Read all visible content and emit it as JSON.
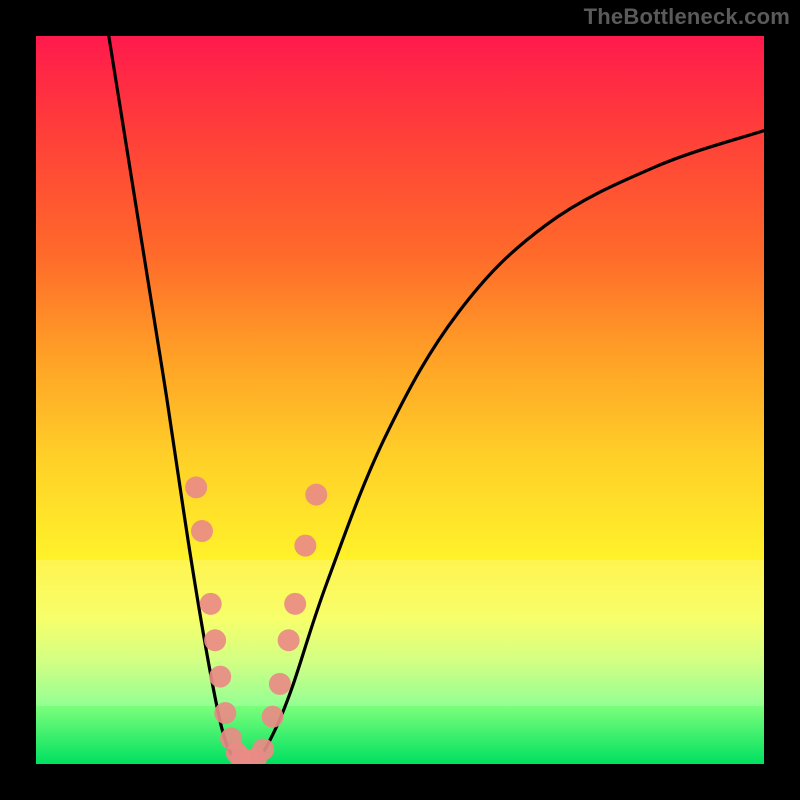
{
  "watermark": "TheBottleneck.com",
  "chart_data": {
    "type": "line",
    "title": "",
    "xlabel": "",
    "ylabel": "",
    "xlim": [
      0,
      100
    ],
    "ylim": [
      0,
      100
    ],
    "series": [
      {
        "name": "left-curve",
        "x": [
          10,
          14,
          18,
          21,
          23.5,
          25.5,
          27,
          28
        ],
        "y": [
          100,
          75,
          50,
          30,
          15,
          5,
          1,
          0
        ]
      },
      {
        "name": "right-curve",
        "x": [
          30,
          32,
          35,
          40,
          48,
          58,
          70,
          85,
          100
        ],
        "y": [
          0,
          3,
          10,
          25,
          45,
          62,
          74,
          82,
          87
        ]
      }
    ],
    "markers": [
      {
        "x": 22.0,
        "y": 38
      },
      {
        "x": 22.8,
        "y": 32
      },
      {
        "x": 24.0,
        "y": 22
      },
      {
        "x": 24.6,
        "y": 17
      },
      {
        "x": 25.3,
        "y": 12
      },
      {
        "x": 26.0,
        "y": 7
      },
      {
        "x": 26.8,
        "y": 3.5
      },
      {
        "x": 27.6,
        "y": 1.5
      },
      {
        "x": 28.2,
        "y": 0.7
      },
      {
        "x": 29.2,
        "y": 0.5
      },
      {
        "x": 30.2,
        "y": 0.7
      },
      {
        "x": 31.2,
        "y": 2.0
      },
      {
        "x": 32.5,
        "y": 6.5
      },
      {
        "x": 33.5,
        "y": 11
      },
      {
        "x": 34.7,
        "y": 17
      },
      {
        "x": 35.6,
        "y": 22
      },
      {
        "x": 37.0,
        "y": 30
      },
      {
        "x": 38.5,
        "y": 37
      }
    ],
    "light_band": {
      "top_pct": 72,
      "bottom_pct": 92
    }
  }
}
